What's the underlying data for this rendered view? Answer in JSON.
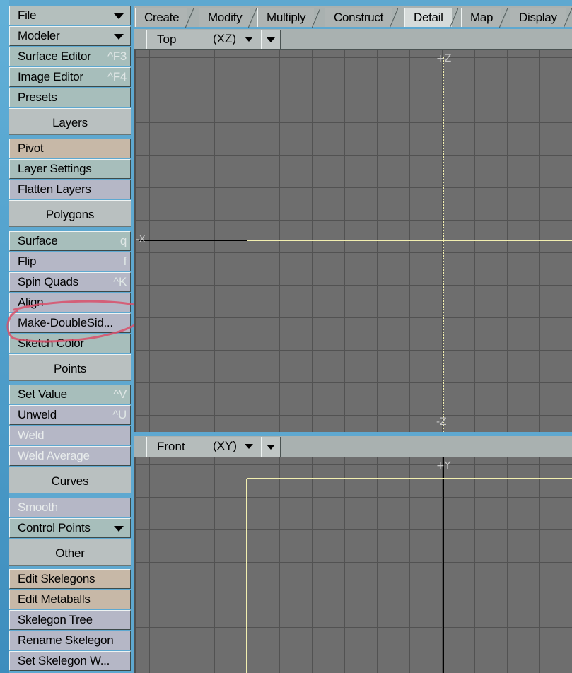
{
  "tool_panel": {
    "file": "File",
    "modeler": "Modeler",
    "surface_editor": "Surface Editor",
    "surface_editor_shortcut": "^F3",
    "image_editor": "Image Editor",
    "image_editor_shortcut": "^F4",
    "presets": "Presets",
    "layers_header": "Layers",
    "pivot": "Pivot",
    "layer_settings": "Layer Settings",
    "flatten_layers": "Flatten Layers",
    "polygons_header": "Polygons",
    "surface": "Surface",
    "surface_shortcut": "q",
    "flip": "Flip",
    "flip_shortcut": "f",
    "spin_quads": "Spin Quads",
    "spin_quads_shortcut": "^K",
    "align": "Align",
    "make_doublesided": "Make-DoubleSid...",
    "sketch_color": "Sketch Color",
    "points_header": "Points",
    "set_value": "Set Value",
    "set_value_shortcut": "^V",
    "unweld": "Unweld",
    "unweld_shortcut": "^U",
    "weld": "Weld",
    "weld_average": "Weld Average",
    "curves_header": "Curves",
    "smooth": "Smooth",
    "control_points": "Control Points",
    "other_header": "Other",
    "edit_skelegons": "Edit Skelegons",
    "edit_metaballs": "Edit Metaballs",
    "skelegon_tree": "Skelegon Tree",
    "rename_skelegon": "Rename Skelegon",
    "set_skelegon_w": "Set Skelegon W..."
  },
  "tabs": [
    "Create",
    "Modify",
    "Multiply",
    "Construct",
    "Detail",
    "Map",
    "Display"
  ],
  "active_tab": "Detail",
  "viewports": {
    "top": {
      "name": "Top",
      "mode": "(XZ)",
      "axis_top": "+Z",
      "axis_bottom": "-Z",
      "axis_left": "-X"
    },
    "front": {
      "name": "Front",
      "mode": "(XY)",
      "axis_top": "+Y"
    }
  },
  "colors": {
    "viewport_bg": "#6e6e6e",
    "grid_line": "#525252",
    "highlight_yellow": "#f2efb0",
    "annotation_red": "#d9506a"
  }
}
